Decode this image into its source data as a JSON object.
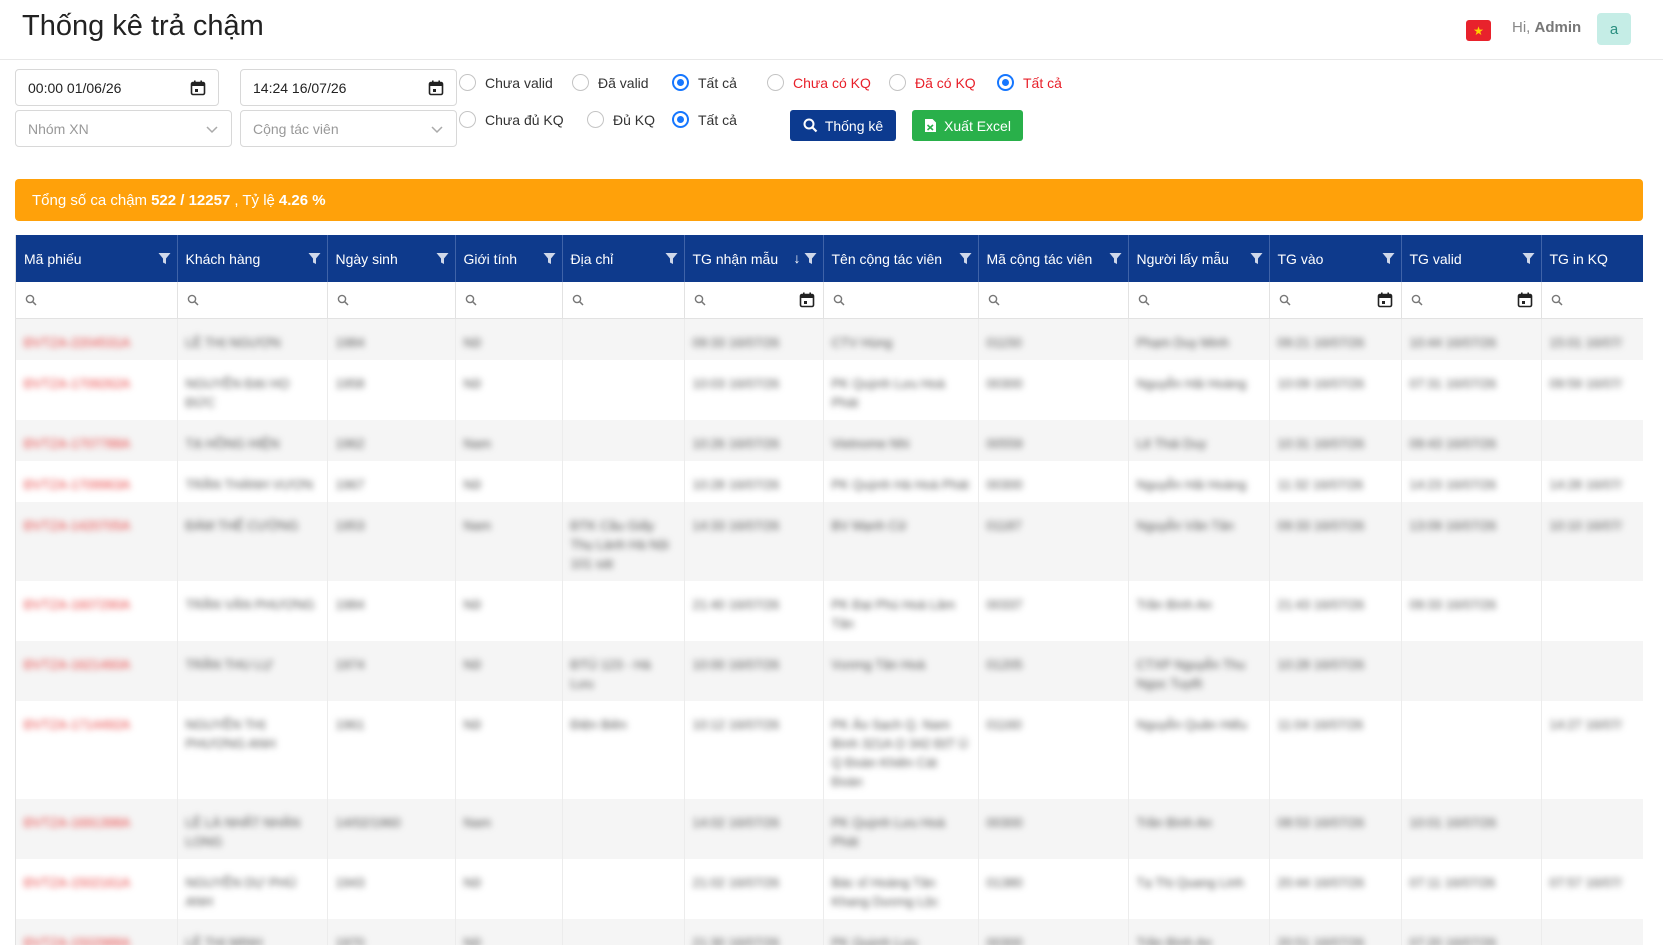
{
  "header": {
    "title": "Thống kê trả chậm",
    "greeting_prefix": "Hi,",
    "username": "Admin",
    "avatar_letter": "a",
    "flag": "★"
  },
  "filters": {
    "from_date": "00:00 01/06/26",
    "to_date": "14:24 16/07/26",
    "group_placeholder": "Nhóm XN",
    "collaborator_placeholder": "Cộng tác viên",
    "valid_options": [
      {
        "label": "Chưa valid",
        "selected": false
      },
      {
        "label": "Đã valid",
        "selected": false
      },
      {
        "label": "Tất cả",
        "selected": true
      }
    ],
    "result_options": [
      {
        "label": "Chưa có KQ",
        "selected": false
      },
      {
        "label": "Đã có KQ",
        "selected": false
      },
      {
        "label": "Tất cả",
        "selected": true
      }
    ],
    "complete_options": [
      {
        "label": "Chưa đủ KQ",
        "selected": false
      },
      {
        "label": "Đủ KQ",
        "selected": false
      },
      {
        "label": "Tất cả",
        "selected": true
      }
    ],
    "stat_button": "Thống kê",
    "excel_button": "Xuất Excel"
  },
  "summary": {
    "prefix": "Tổng số ca chậm",
    "count": "522 / 12257",
    "rate_label": ", Tỷ lệ",
    "rate": "4.26 %"
  },
  "colors": {
    "header_bg": "#0e3a8c",
    "summary_bg": "#ffa10a",
    "primary_button": "#0c3a8f",
    "excel_button": "#29b04a",
    "accent_red": "#e8202a",
    "radio_blue": "#1677ff"
  },
  "table": {
    "columns": [
      "Mã phiếu",
      "Khách hàng",
      "Ngày sinh",
      "Giới tính",
      "Địa chỉ",
      "TG nhận mẫu",
      "Tên cộng tác viên",
      "Mã cộng tác viên",
      "Người lấy mẫu",
      "TG vào",
      "TG valid",
      "TG in KQ"
    ],
    "sorted_column": "TG nhận mẫu",
    "sort_direction": "desc",
    "date_filter_columns": [
      "TG nhận mẫu",
      "TG vào",
      "TG valid"
    ],
    "rows": [
      [
        "ĐVTZA-2204531A",
        "LÊ THỊ NGƯƠN",
        "1984",
        "Nữ",
        "",
        "09:33 16/07/26",
        "CTV Hùng",
        "01150",
        "Phạm Duy Minh",
        "09:21 16/07/26",
        "10:44 16/07/26",
        "15:01 16/07/"
      ],
      [
        "ĐVTZA-1709262A",
        "NGUYỄN ĐẠI HỌ ĐỨC",
        "1958",
        "Nữ",
        "",
        "10:03 16/07/26",
        "PK Quỳnh Lưu Hoà Phát",
        "00300",
        "Nguyễn Hải Hoàng",
        "10:09 16/07/26",
        "07:31 16/07/26",
        "09:59 16/07/"
      ],
      [
        "ĐVTZA-1707788A",
        "TẠ HỒNG HIỆN",
        "1962",
        "Nam",
        "",
        "10:26 16/07/26",
        "Vietnome Nhi",
        "00559",
        "Lê Thái Duy",
        "10:31 16/07/26",
        "09:43 16/07/26",
        ""
      ],
      [
        "ĐVTZA-1709963A",
        "TRẦN THÀNH VƯƠN",
        "1967",
        "Nữ",
        "",
        "10:28 16/07/26",
        "PK Quỳnh Hà Hoà Phát",
        "00300",
        "Nguyễn Hải Hoàng",
        "11:32 16/07/26",
        "14:23 16/07/26",
        "14:28 16/07/"
      ],
      [
        "ĐVTZA-1420705A",
        "ĐÀM THẾ CƯỜNG",
        "1953",
        "Nam",
        "ĐTK Cầu Giấy Thụ Lành Hà Nội 101 sát",
        "14:33 16/07/26",
        "BV Mạnh Cử",
        "01187",
        "Nguyễn Văn Tân",
        "09:33 16/07/26",
        "13:09 16/07/26",
        "10:10 16/07/"
      ],
      [
        "ĐVTZA-1607290A",
        "TRẦN VĂN PHƯƠNG",
        "1984",
        "Nữ",
        "",
        "21:40 16/07/26",
        "PK Đại Phú Hoà Lâm Tân",
        "00337",
        "Trần Bình An",
        "21:43 16/07/26",
        "09:33 16/07/26",
        ""
      ],
      [
        "ĐVTZA-1621460A",
        "TRẦN THU LỰ",
        "1974",
        "Nữ",
        "ĐTÚ 123 - Hà Lưu",
        "10:00 16/07/26",
        "Vương Tân Hoà",
        "01205",
        "CTXP Nguyễn Thu Ngọc Tuyết",
        "10:28 16/07/26",
        "",
        ""
      ],
      [
        "ĐVTZA-1714492A",
        "NGUYỄN THỊ PHƯƠNG ANH",
        "1961",
        "Nữ",
        "Điện Biên",
        "10:12 16/07/26",
        "PK Ảo Sạch Q. Nam Bình 321A Ọ 342 ĐỊT Ú Q Đoàn Khiên Cát Đoàn",
        "01160",
        "Nguyễn Quân Hiếu",
        "11:04 16/07/26",
        "",
        "14:27 16/07/"
      ],
      [
        "ĐVTZA-1691398A",
        "LÊ LÀ NHẤT NHÂN LONG",
        "14/02/1960",
        "Nam",
        "",
        "14:02 16/07/26",
        "PK Quỳnh Lưu Hoà Phát",
        "00300",
        "Trần Bình An",
        "08:53 16/07/26",
        "10:01 16/07/26",
        ""
      ],
      [
        "ĐVTZA-1502161A",
        "NGUYỄN DỰ PHÚ ANH",
        "1943",
        "Nữ",
        "",
        "21:02 16/07/26",
        "Bác sĩ Hoàng Tân Khang Dương Lộc",
        "01380",
        "Tạ Thị Quang Linh",
        "20:44 16/07/26",
        "07:11 16/07/26",
        "07:57 16/07/"
      ],
      [
        "ĐVTZA-1502988A",
        "LÊ THỊ MINH",
        "1970",
        "Nữ",
        "",
        "21:30 16/07/26",
        "PK Quỳnh Lưu",
        "00300",
        "Trần Bình An",
        "20:51 16/07/26",
        "07:20 16/07/26",
        ""
      ]
    ]
  }
}
